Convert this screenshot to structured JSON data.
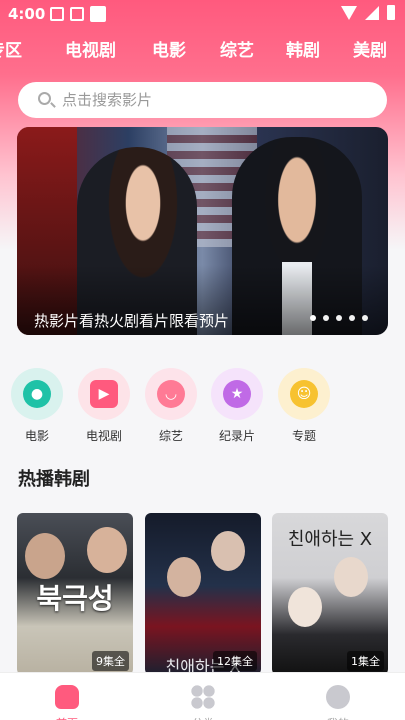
{
  "status_bar": {
    "time": "4:00"
  },
  "tabs": [
    {
      "label": "专区"
    },
    {
      "label": "电视剧"
    },
    {
      "label": "电影"
    },
    {
      "label": "综艺"
    },
    {
      "label": "韩剧"
    },
    {
      "label": "美剧"
    }
  ],
  "search": {
    "placeholder": "点击搜索影片"
  },
  "banner": {
    "caption": "热影片看热火剧看片限看预片",
    "slide_count": 5,
    "active_index": 0
  },
  "categories": [
    {
      "label": "电影",
      "icon": "film-reel-icon"
    },
    {
      "label": "电视剧",
      "icon": "tv-icon"
    },
    {
      "label": "综艺",
      "icon": "bear-icon"
    },
    {
      "label": "纪录片",
      "icon": "star-icon"
    },
    {
      "label": "专题",
      "icon": "smiley-icon"
    }
  ],
  "section": {
    "title": "热播韩剧"
  },
  "posters": [
    {
      "title_art": "북극성",
      "episodes": "9集全"
    },
    {
      "title_art": "친애하는 X",
      "episodes": "12集全"
    },
    {
      "title_art": "친애하는 X",
      "episodes": "1集全"
    }
  ],
  "bottom_nav": [
    {
      "label": "首页",
      "icon": "home-icon",
      "active": true
    },
    {
      "label": "分类",
      "icon": "grid-icon",
      "active": false
    },
    {
      "label": "我的",
      "icon": "profile-icon",
      "active": false
    }
  ],
  "colors": {
    "accent": "#ff5a7e",
    "header_top": "#ff5a7e"
  }
}
